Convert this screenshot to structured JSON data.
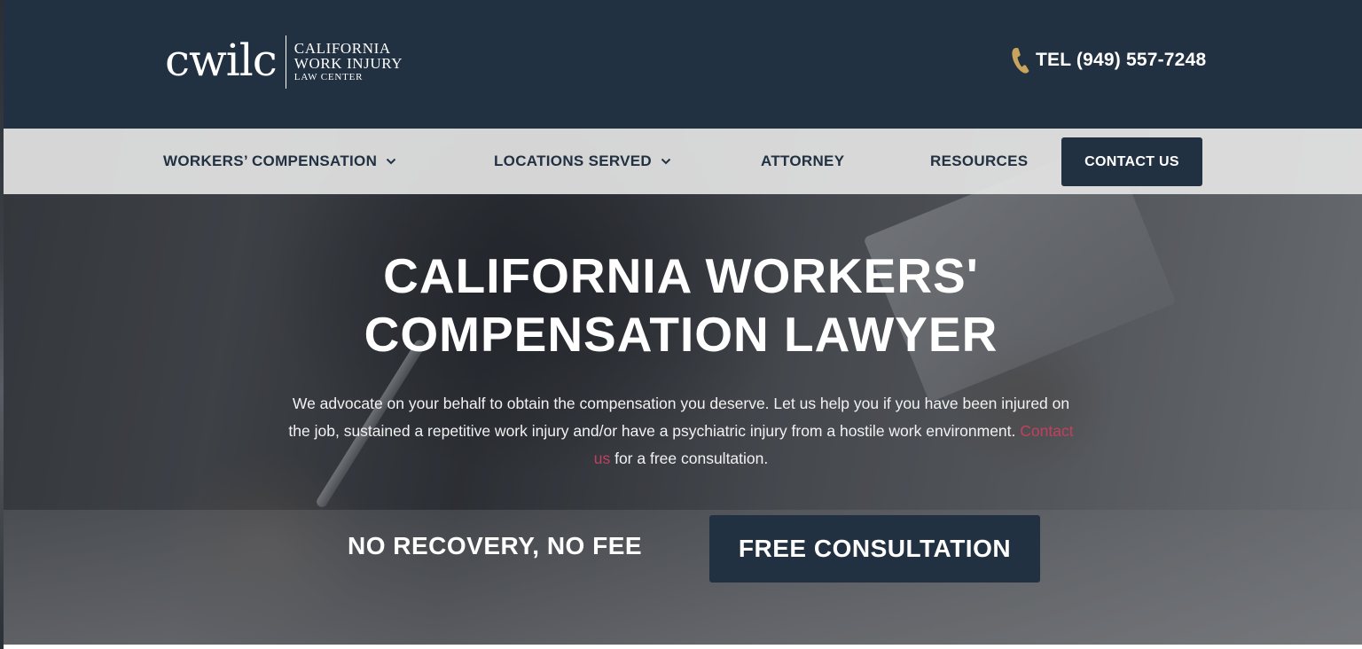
{
  "header": {
    "logo": {
      "mark": "cwilc",
      "line1": "CALIFORNIA",
      "line2": "WORK INJURY",
      "line3": "LAW CENTER"
    },
    "phone": {
      "icon": "phone-icon",
      "label": "TEL (949) 557-7248"
    }
  },
  "nav": {
    "items": [
      {
        "label": "WORKERS’ COMPENSATION",
        "has_dropdown": true
      },
      {
        "label": "LOCATIONS SERVED",
        "has_dropdown": true
      },
      {
        "label": "ATTORNEY",
        "has_dropdown": false
      },
      {
        "label": "RESOURCES",
        "has_dropdown": false
      }
    ],
    "cta": "CONTACT US"
  },
  "hero": {
    "title_line1": "CALIFORNIA WORKERS'",
    "title_line2": "COMPENSATION LAWYER",
    "description_before": "We advocate on your behalf to obtain the compensation you deserve. Let us help you if you have been injured on the job, sustained a repetitive work injury and/or have a psychiatric injury from a hostile work environment. ",
    "description_link": "Contact us",
    "description_after": " for a free consultation.",
    "tagline": "NO RECOVERY, NO FEE",
    "cta": "FREE CONSULTATION"
  },
  "colors": {
    "navy": "#223141",
    "nav_background": "#e8e8e8",
    "link": "#c2405f",
    "phone_icon": "#c9a45c"
  }
}
